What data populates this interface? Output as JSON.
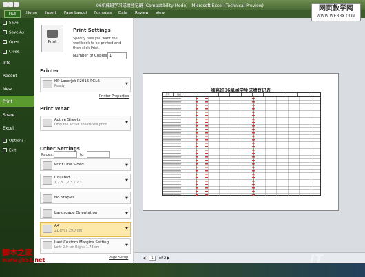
{
  "window": {
    "title": "06机械班学习成绩登记册 [Compatibility Mode] - Microsoft Excel (Technical Preview)"
  },
  "ribbon": {
    "file_label": "FILE",
    "tabs": [
      "Home",
      "Insert",
      "Page Layout",
      "Formulas",
      "Data",
      "Review",
      "View"
    ]
  },
  "backstage_nav": {
    "items": [
      "Save",
      "Save As",
      "Open",
      "Close",
      "Info",
      "Recent",
      "New",
      "Print",
      "Share",
      "Excel",
      "Options",
      "Exit"
    ],
    "active": "Print"
  },
  "print_panel": {
    "print_button_label": "Print",
    "settings_title": "Print Settings",
    "settings_desc": "Specify how you want the workbook to be printed and then click Print.",
    "copies_label": "Number of Copies:",
    "copies_value": "1",
    "printer_section": "Printer",
    "printer_name": "HP LaserJet P2015 PCL6",
    "printer_status": "Ready",
    "printer_properties_link": "Printer Properties",
    "print_what_section": "Print What",
    "print_what_main": "Active Sheets",
    "print_what_sub": "Only the active sheets will print",
    "pages_label": "Pages:",
    "to_label": "to",
    "other_settings_section": "Other Settings",
    "sided_main": "Print One Sided",
    "collated_main": "Collated",
    "collated_sub": "1,2,3    1,2,3    1,2,3",
    "staples_main": "No Staples",
    "orientation_main": "Landscape Orientation",
    "paper_main": "A4",
    "paper_sub": "21 cm x 29.7 cm",
    "margins_main": "Last Custom Margins Setting",
    "margins_sub": "Left: 2.9 cm   Right: 1.78 cm",
    "page_setup_link": "Page Setup"
  },
  "preview": {
    "sheet_title": "综高班06机械学生成绩登记表",
    "header_cells": [
      "序号",
      "姓名",
      "",
      "",
      "",
      "",
      "",
      "",
      "",
      "",
      "",
      "",
      "",
      "",
      ""
    ],
    "current_page": "1",
    "total_pages": "of 2"
  },
  "watermarks": {
    "top_right_line1": "网页教学网",
    "top_right_line2": "WWW.WEB3X.COM",
    "bottom_left_line1": "脚本之家",
    "bottom_left_line2": "www.jb51.net",
    "bottom_right": "IT"
  }
}
